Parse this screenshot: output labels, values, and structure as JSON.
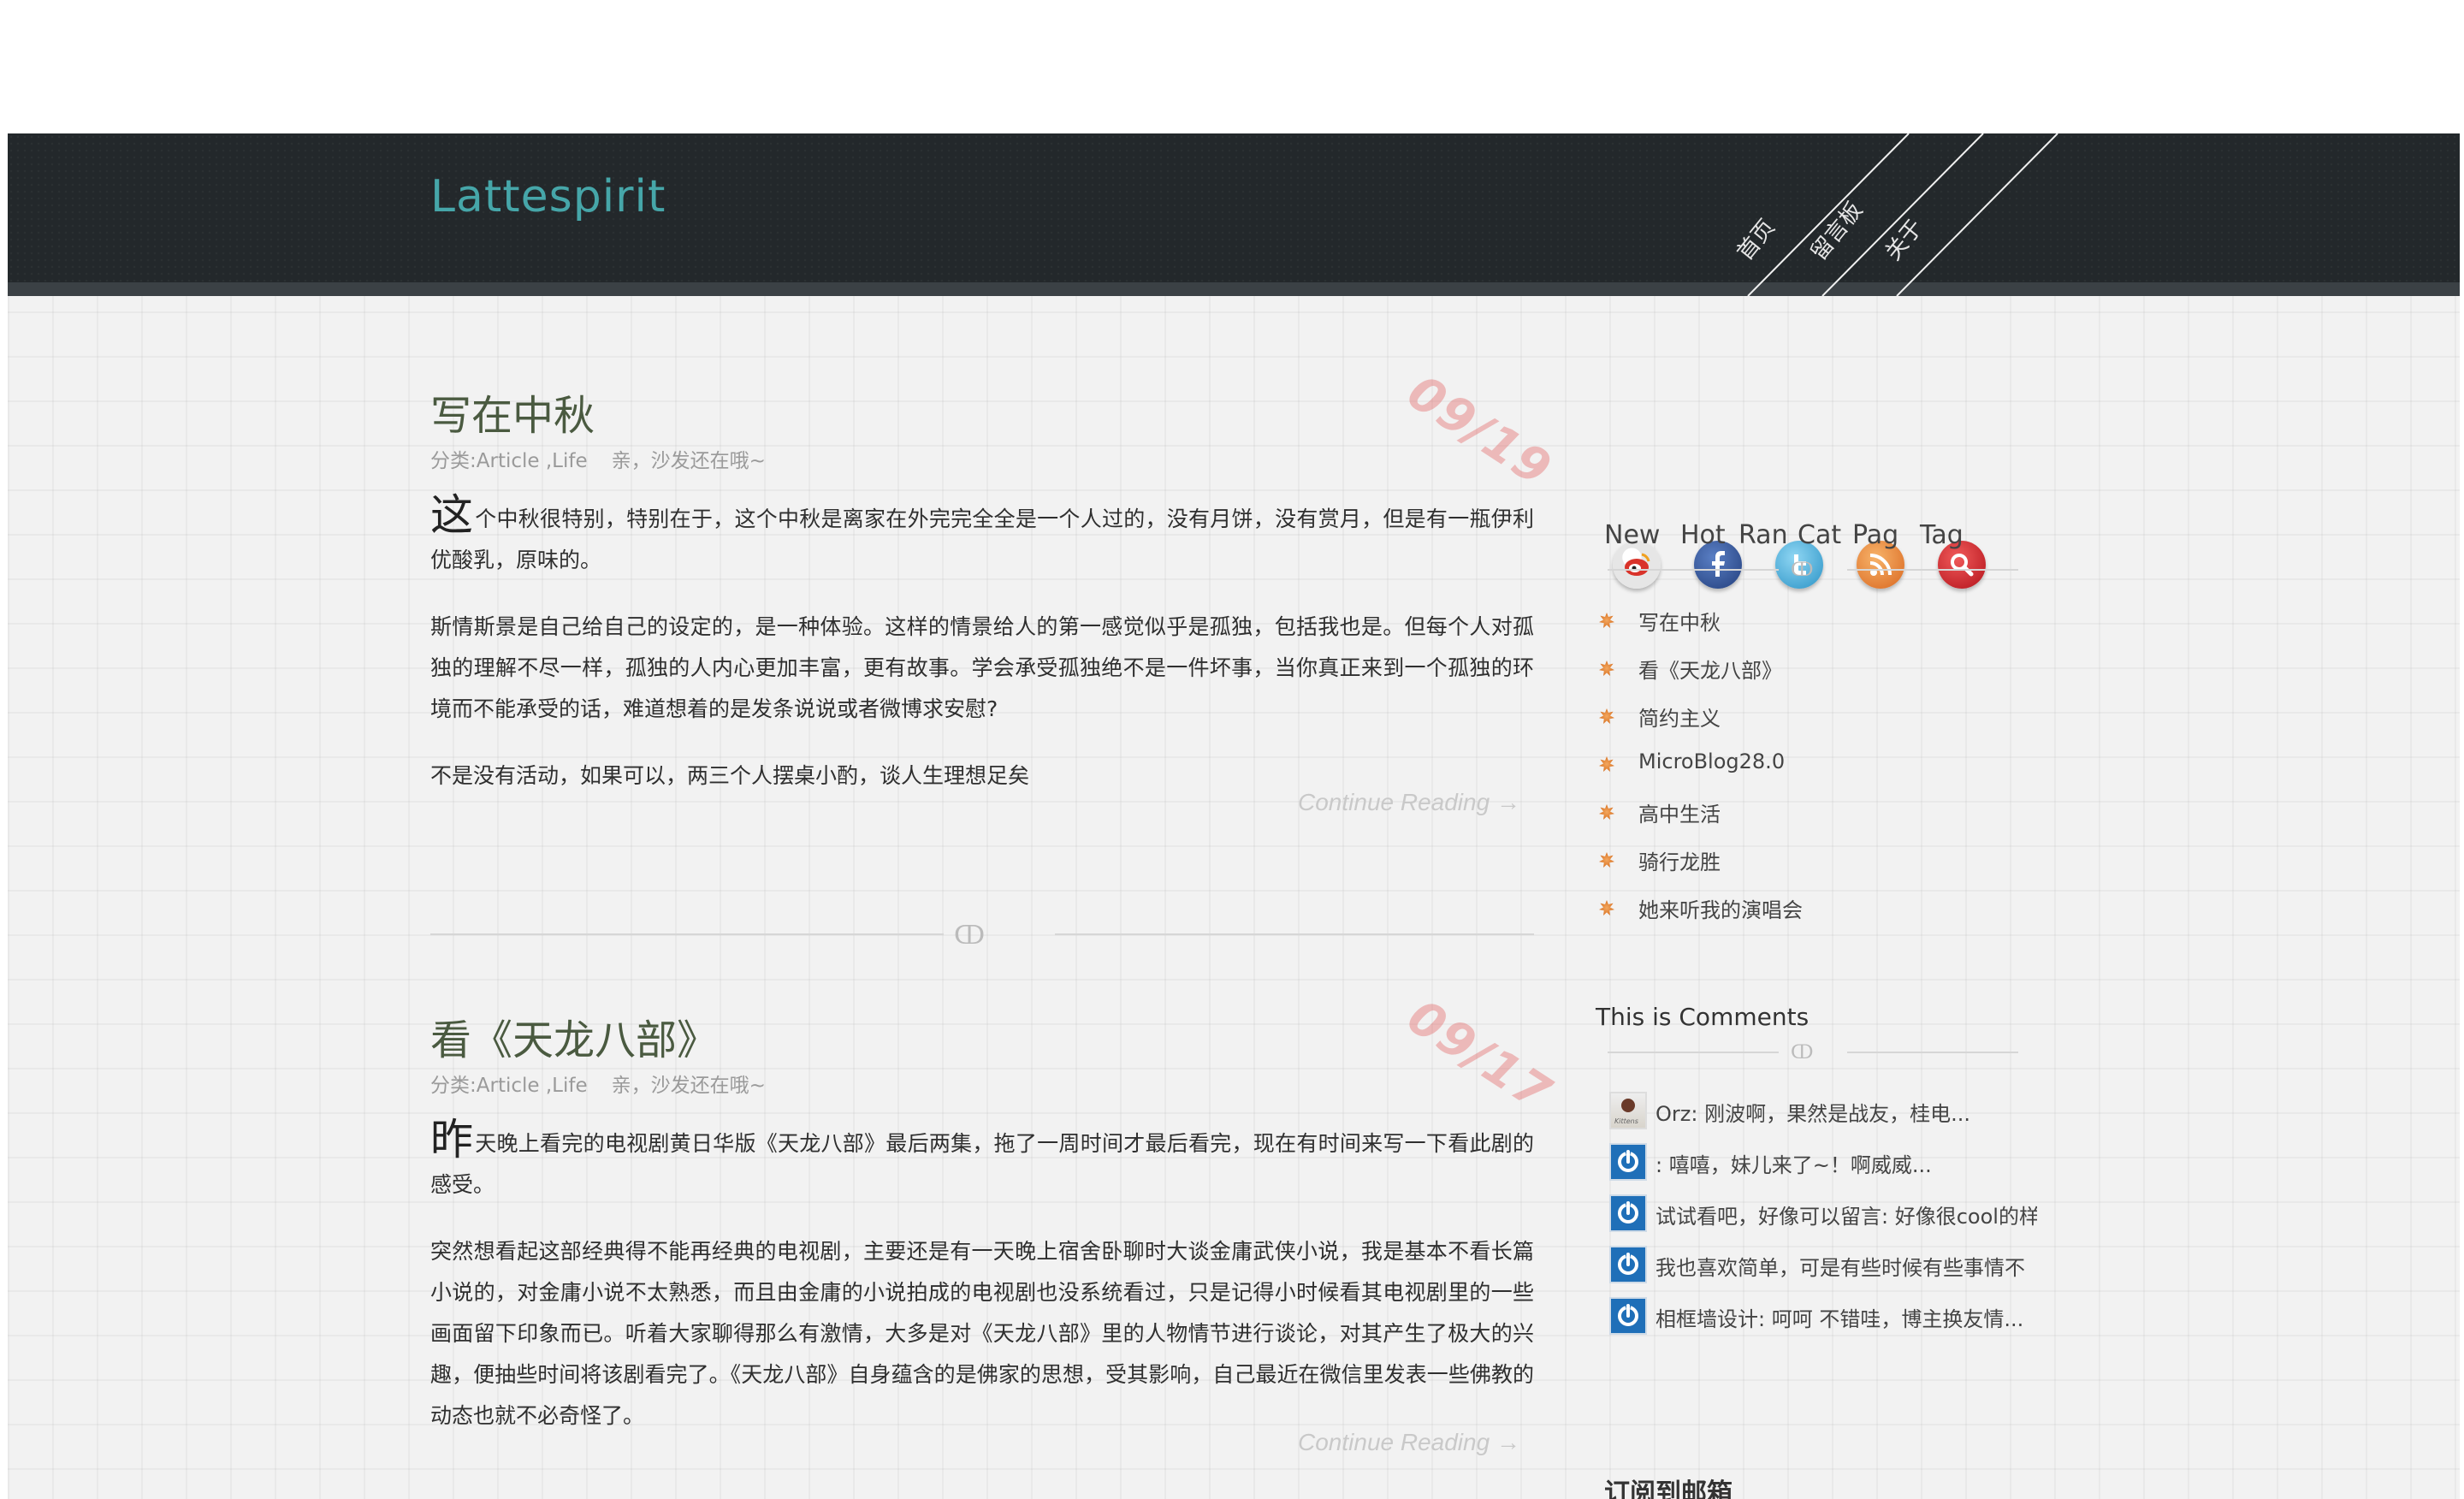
{
  "site": {
    "logo": "Lattespirit"
  },
  "nav": [
    {
      "label": "首页"
    },
    {
      "label": "留言板"
    },
    {
      "label": "关于"
    }
  ],
  "posts": [
    {
      "title": "写在中秋",
      "category_label": "分类:",
      "categories": "Article ,Life",
      "comments": "亲，沙发还在哦~",
      "date": "09/19",
      "dropcap": "这",
      "paragraphs": [
        "个中秋很特别，特别在于，这个中秋是离家在外完完全全是一个人过的，没有月饼，没有赏月，但是有一瓶伊利优酸乳，原味的。",
        "斯情斯景是自己给自己的设定的，是一种体验。这样的情景给人的第一感觉似乎是孤独，包括我也是。但每个人对孤独的理解不尽一样，孤独的人内心更加丰富，更有故事。学会承受孤独绝不是一件坏事，当你真正来到一个孤独的环境而不能承受的话，难道想着的是发条说说或者微博求安慰?",
        "不是没有活动，如果可以，两三个人摆桌小酌，谈人生理想足矣"
      ],
      "continue": "Continue Reading →"
    },
    {
      "title": "看《天龙八部》",
      "category_label": "分类:",
      "categories": "Article ,Life",
      "comments": "亲，沙发还在哦~",
      "date": "09/17",
      "dropcap": "昨",
      "paragraphs": [
        "天晚上看完的电视剧黄日华版《天龙八部》最后两集，拖了一周时间才最后看完，现在有时间来写一下看此剧的感受。",
        "突然想看起这部经典得不能再经典的电视剧，主要还是有一天晚上宿舍卧聊时大谈金庸武侠小说，我是基本不看长篇小说的，对金庸小说不太熟悉，而且由金庸的小说拍成的电视剧也没系统看过，只是记得小时候看其电视剧里的一些画面留下印象而已。听着大家聊得那么有激情，大多是对《天龙八部》里的人物情节进行谈论，对其产生了极大的兴趣，便抽些时间将该剧看完了。《天龙八部》自身蕴含的是佛家的思想，受其影响，自己最近在微信里发表一些佛教的动态也就不必奇怪了。"
      ],
      "continue": "Continue Reading →"
    }
  ],
  "social": [
    {
      "icon": "weibo-icon",
      "color": "#d9332a"
    },
    {
      "icon": "facebook-icon",
      "color": "#2d4f8f"
    },
    {
      "icon": "twitter-icon",
      "color": "#3aa7d8"
    },
    {
      "icon": "rss-icon",
      "color": "#e8782a"
    },
    {
      "icon": "search-icon",
      "color": "#c8161d"
    }
  ],
  "sidebar": {
    "tabs": [
      "New",
      "Hot",
      "Ran",
      "Cat",
      "Pag",
      "Tag"
    ],
    "recent_posts": [
      "写在中秋",
      "看《天龙八部》",
      "简约主义",
      "MicroBlog28.0",
      "高中生活",
      "骑行龙胜",
      "她来听我的演唱会"
    ],
    "comments_title": "This is Comments",
    "comments": [
      {
        "avatar": "photo-avatar",
        "avatar_caption": "Kittens",
        "text": "Orz: 刚波啊，果然是战友，桂电..."
      },
      {
        "avatar": "power-avatar",
        "text": ": 嘻嘻，妹儿来了~！啊威威..."
      },
      {
        "avatar": "power-avatar",
        "text": "试试看吧，好像可以留言: 好像很cool的样"
      },
      {
        "avatar": "power-avatar",
        "text": "我也喜欢简单，可是有些时候有些事情不"
      },
      {
        "avatar": "power-avatar",
        "text": "相框墙设计: 呵呵 不错哇，博主换友情..."
      }
    ],
    "subscribe_title": "订阅到邮箱"
  }
}
